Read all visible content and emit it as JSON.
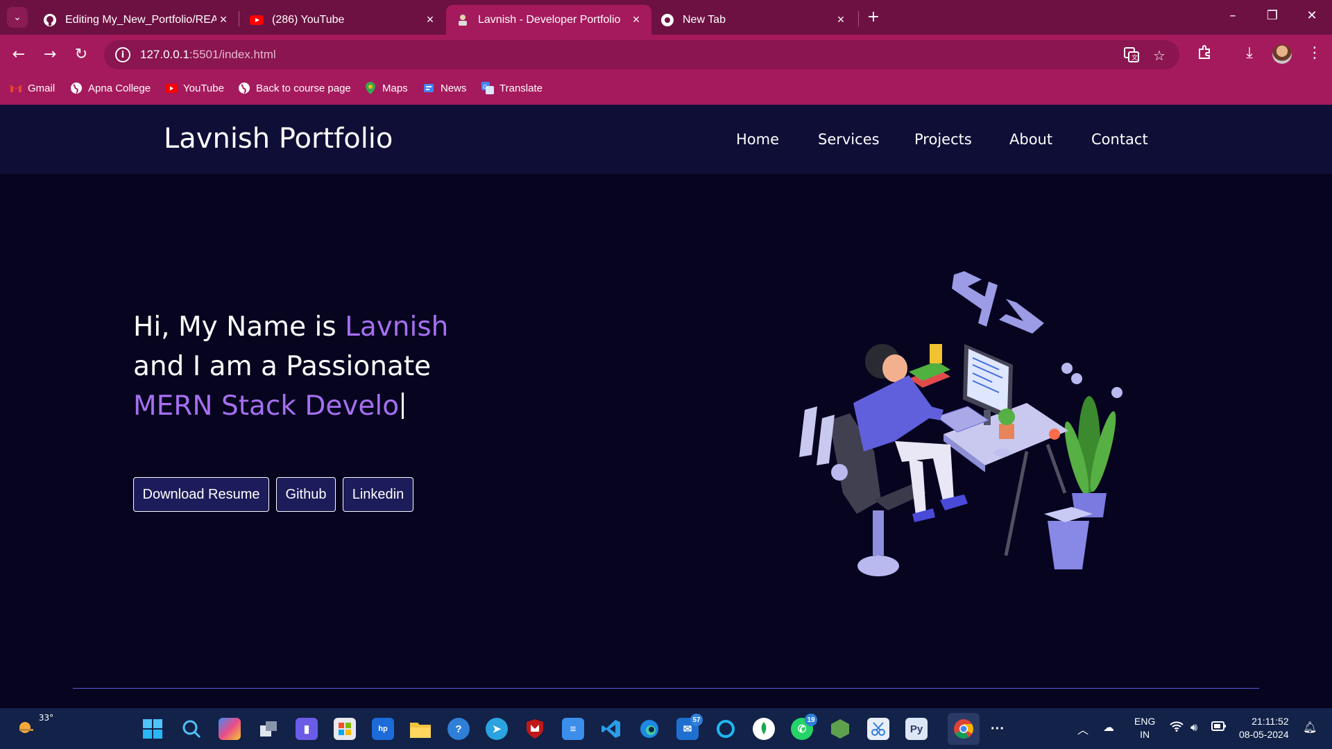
{
  "browser": {
    "tabs": [
      {
        "label": "Editing My_New_Portfolio/README",
        "icon": "github-icon",
        "active": false
      },
      {
        "label": "(286) YouTube",
        "icon": "youtube-icon",
        "active": false
      },
      {
        "label": "Lavnish - Developer Portfolio",
        "icon": "portfolio-favicon",
        "active": true
      },
      {
        "label": "New Tab",
        "icon": "chrome-icon",
        "active": false
      }
    ],
    "url_host": "127.0.0.1",
    "url_path": ":5501/index.html",
    "bookmarks": [
      "Gmail",
      "Apna College",
      "YouTube",
      "Back to course page",
      "Maps",
      "News",
      "Translate"
    ],
    "accent": "#a51a5c",
    "tabbar_color": "#6d1142"
  },
  "site": {
    "brand": "Lavnish Portfolio",
    "nav": [
      "Home",
      "Services",
      "Projects",
      "About",
      "Contact"
    ],
    "hero": {
      "line1_prefix": "Hi, My Name is ",
      "name": "Lavnish",
      "line2": "and I am a Passionate",
      "typed_text": "MERN Stack Develo"
    },
    "buttons": [
      "Download Resume",
      "Github",
      "Linkedin"
    ],
    "accent": "#a66ff0",
    "background": "#06041f"
  },
  "taskbar": {
    "weather": "33°",
    "badges": {
      "mail": "57",
      "whatsapp": "19"
    },
    "lang_top": "ENG",
    "lang_bottom": "IN",
    "time": "21:11:52",
    "date": "08-05-2024"
  }
}
